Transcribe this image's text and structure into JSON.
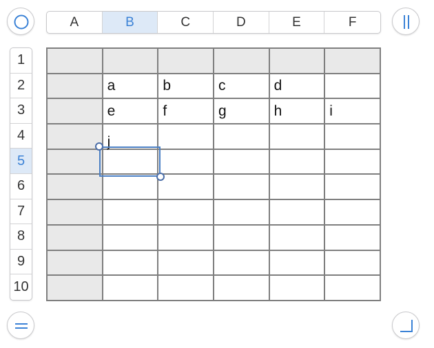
{
  "columns": [
    "A",
    "B",
    "C",
    "D",
    "E",
    "F"
  ],
  "rows": [
    "1",
    "2",
    "3",
    "4",
    "5",
    "6",
    "7",
    "8",
    "9",
    "10"
  ],
  "selected_column": "B",
  "selected_row": "5",
  "cells": {
    "row2": [
      "",
      "a",
      "b",
      "c",
      "d",
      ""
    ],
    "row3": [
      "",
      "e",
      "f",
      "g",
      "h",
      "i"
    ],
    "row4": [
      "",
      "j",
      "",
      "",
      "",
      ""
    ]
  },
  "icons": {
    "top_left": "circle-icon",
    "top_right": "pause-icon",
    "bottom_left": "equals-icon",
    "bottom_right": "corner-icon"
  },
  "colors": {
    "accent": "#3b82d6",
    "selection_bg": "#dde9f7",
    "header_shade": "#e9e9e9",
    "grid_line": "#7e7e7e"
  }
}
